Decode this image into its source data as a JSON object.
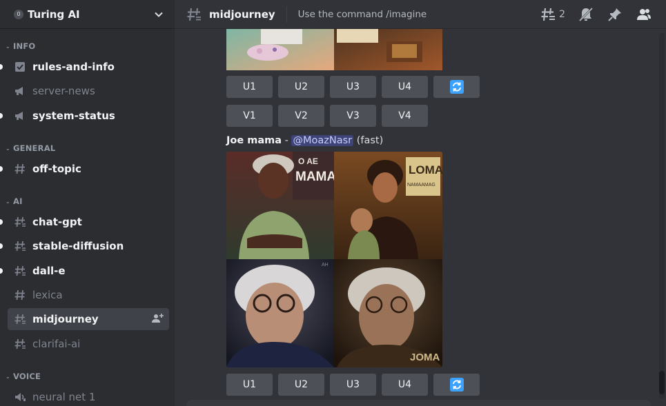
{
  "server": {
    "name": "Turing AI",
    "badge": "0"
  },
  "sidebar": {
    "categories": [
      {
        "name": "INFO"
      },
      {
        "name": "GENERAL"
      },
      {
        "name": "AI"
      },
      {
        "name": "VOICE"
      }
    ],
    "channels": [
      {
        "label": "rules-and-info",
        "icon": "rules-icon"
      },
      {
        "label": "server-news",
        "icon": "announcement-icon"
      },
      {
        "label": "system-status",
        "icon": "announcement-icon"
      },
      {
        "label": "off-topic",
        "icon": "hash-icon"
      },
      {
        "label": "chat-gpt",
        "icon": "thread-hash-icon"
      },
      {
        "label": "stable-diffusion",
        "icon": "thread-hash-icon"
      },
      {
        "label": "dall-e",
        "icon": "thread-hash-icon"
      },
      {
        "label": "lexica",
        "icon": "hash-icon"
      },
      {
        "label": "midjourney",
        "icon": "thread-hash-icon"
      },
      {
        "label": "clarifai-ai",
        "icon": "thread-hash-icon"
      },
      {
        "label": "neural net 1",
        "icon": "speaker-icon"
      }
    ]
  },
  "header": {
    "channel": "midjourney",
    "topic": "Use the command /imagine",
    "thread_count": "2"
  },
  "messages": {
    "top_buttons_row1": [
      "U1",
      "U2",
      "U3",
      "U4"
    ],
    "top_buttons_row2": [
      "V1",
      "V2",
      "V3",
      "V4"
    ],
    "second": {
      "author": "Joe mama",
      "separator": " - ",
      "mention": "@MoazNasr",
      "suffix": " (fast)",
      "buttons": [
        "U1",
        "U2",
        "U3",
        "U4"
      ]
    },
    "image_text": {
      "tl": [
        "O AE",
        "MAMA"
      ],
      "tr": "LOMA",
      "tr_small": "NAMAAMAG",
      "br": "JOMA",
      "bl_corner": "AH"
    }
  },
  "colors": {
    "accent": "#5865f2",
    "refresh": "#3ba2ff"
  }
}
